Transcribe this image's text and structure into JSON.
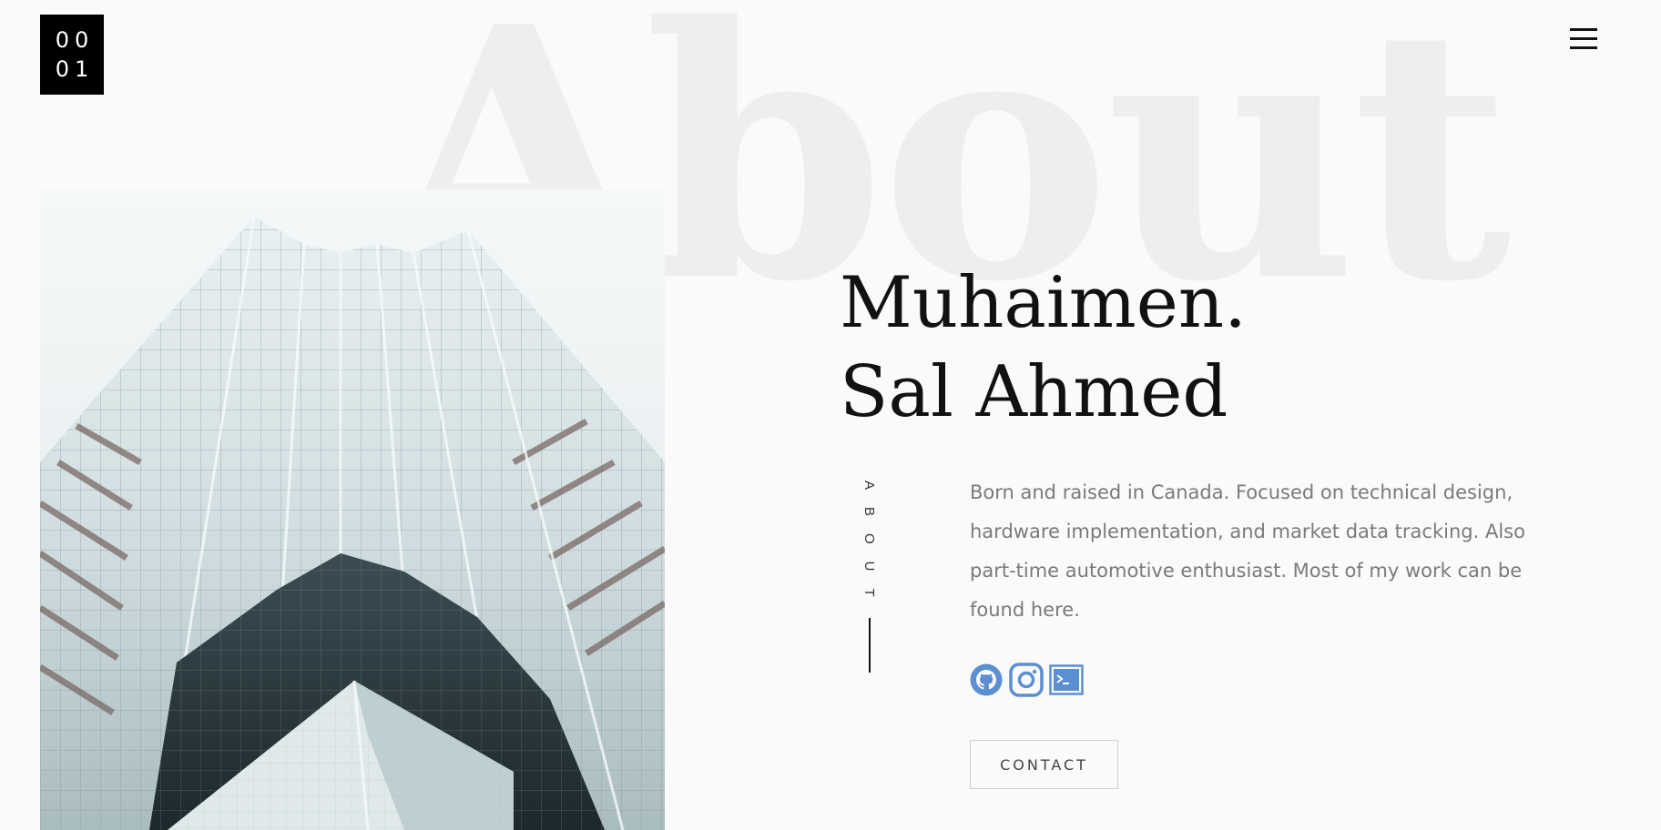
{
  "brand": {
    "logo_line1": "00",
    "logo_line2": "01"
  },
  "background_word": "About",
  "hero": {
    "name_line1": "Muhaimen.",
    "name_line2": "Sal Ahmed"
  },
  "section_label": "ABOUT",
  "bio": "Born and raised in Canada. Focused on technical design, hardware implementation, and market data tracking. Also part-time automotive enthusiast. Most of my work can be found here.",
  "socials": [
    {
      "icon": "github-icon"
    },
    {
      "icon": "instagram-icon"
    },
    {
      "icon": "terminal-icon"
    }
  ],
  "contact_label": "CONTACT",
  "colors": {
    "accent": "#5b8fcf",
    "background": "#fafafa",
    "text": "#111111",
    "muted": "#7a7a7a",
    "watermark": "#eeeeee"
  }
}
